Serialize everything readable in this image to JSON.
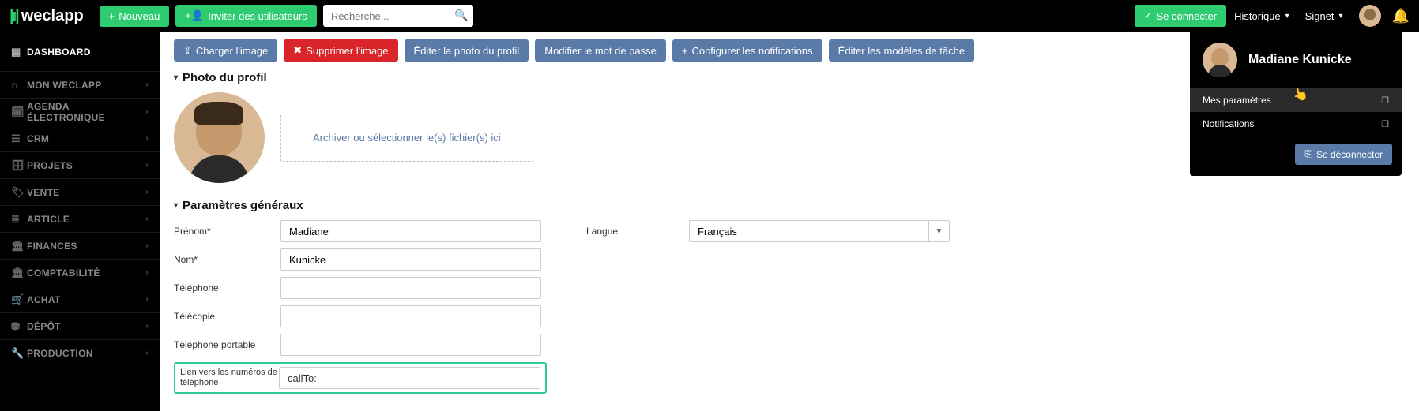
{
  "brand": "weclapp",
  "topbar": {
    "new_label": "Nouveau",
    "invite_label": "Inviter des utilisateurs",
    "search_placeholder": "Recherche...",
    "connect_label": "Se connecter",
    "history_label": "Historique",
    "bookmark_label": "Signet"
  },
  "sidebar": {
    "items": [
      {
        "label": "DASHBOARD",
        "icon": "▦"
      },
      {
        "label": "MON WECLAPP",
        "icon": "⌂"
      },
      {
        "label": "AGENDA ÉLECTRONIQUE",
        "icon": "🗓"
      },
      {
        "label": "CRM",
        "icon": "☰"
      },
      {
        "label": "PROJETS",
        "icon": "🗄"
      },
      {
        "label": "VENTE",
        "icon": "🏷"
      },
      {
        "label": "ARTICLE",
        "icon": "≣"
      },
      {
        "label": "FINANCES",
        "icon": "🏛"
      },
      {
        "label": "COMPTABILITÉ",
        "icon": "🏛"
      },
      {
        "label": "ACHAT",
        "icon": "🛒"
      },
      {
        "label": "DÉPÔT",
        "icon": "⛃"
      },
      {
        "label": "PRODUCTION",
        "icon": "🔧"
      }
    ]
  },
  "actions": {
    "upload": "Charger l'image",
    "delete": "Supprimer l'image",
    "edit_photo": "Éditer la photo du profil",
    "change_pw": "Modifier le mot de passe",
    "config_notif": "Configurer les notifications",
    "edit_templates": "Éditer les modèles de tâche"
  },
  "sections": {
    "photo_title": "Photo du profil",
    "dropzone": "Archiver ou sélectionner le(s) fichier(s) ici",
    "general_title": "Paramètres généraux"
  },
  "form": {
    "firstname_label": "Prénom*",
    "firstname_value": "Madiane",
    "lastname_label": "Nom*",
    "lastname_value": "Kunicke",
    "phone_label": "Téléphone",
    "fax_label": "Télécopie",
    "mobile_label": "Téléphone portable",
    "phonelink_label": "Lien vers les numéros de téléphone",
    "phonelink_value": "callTo:",
    "lang_label": "Langue",
    "lang_value": "Français"
  },
  "user_menu": {
    "name": "Madiane Kunicke",
    "my_params": "Mes paramètres",
    "notifications": "Notifications",
    "logout": "Se déconnecter"
  }
}
